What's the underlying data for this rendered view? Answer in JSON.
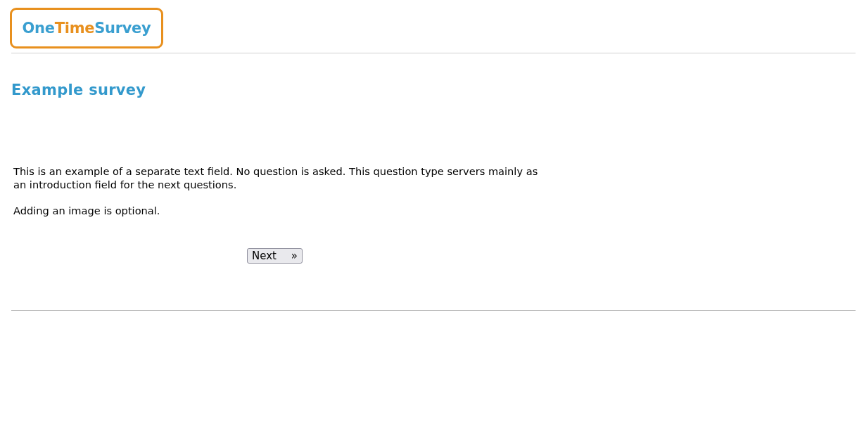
{
  "logo": {
    "parts": [
      {
        "text": "One",
        "kind": "primary"
      },
      {
        "text": "Time",
        "kind": "accent"
      },
      {
        "text": "Survey",
        "kind": "primary"
      }
    ]
  },
  "title": "Example survey",
  "paragraphs": [
    "This is an example of a separate text field. No question is asked. This question type servers mainly as an introduction field for the next questions.",
    "Adding an image is optional."
  ],
  "next_button": {
    "label": "Next",
    "arrow": "»"
  }
}
